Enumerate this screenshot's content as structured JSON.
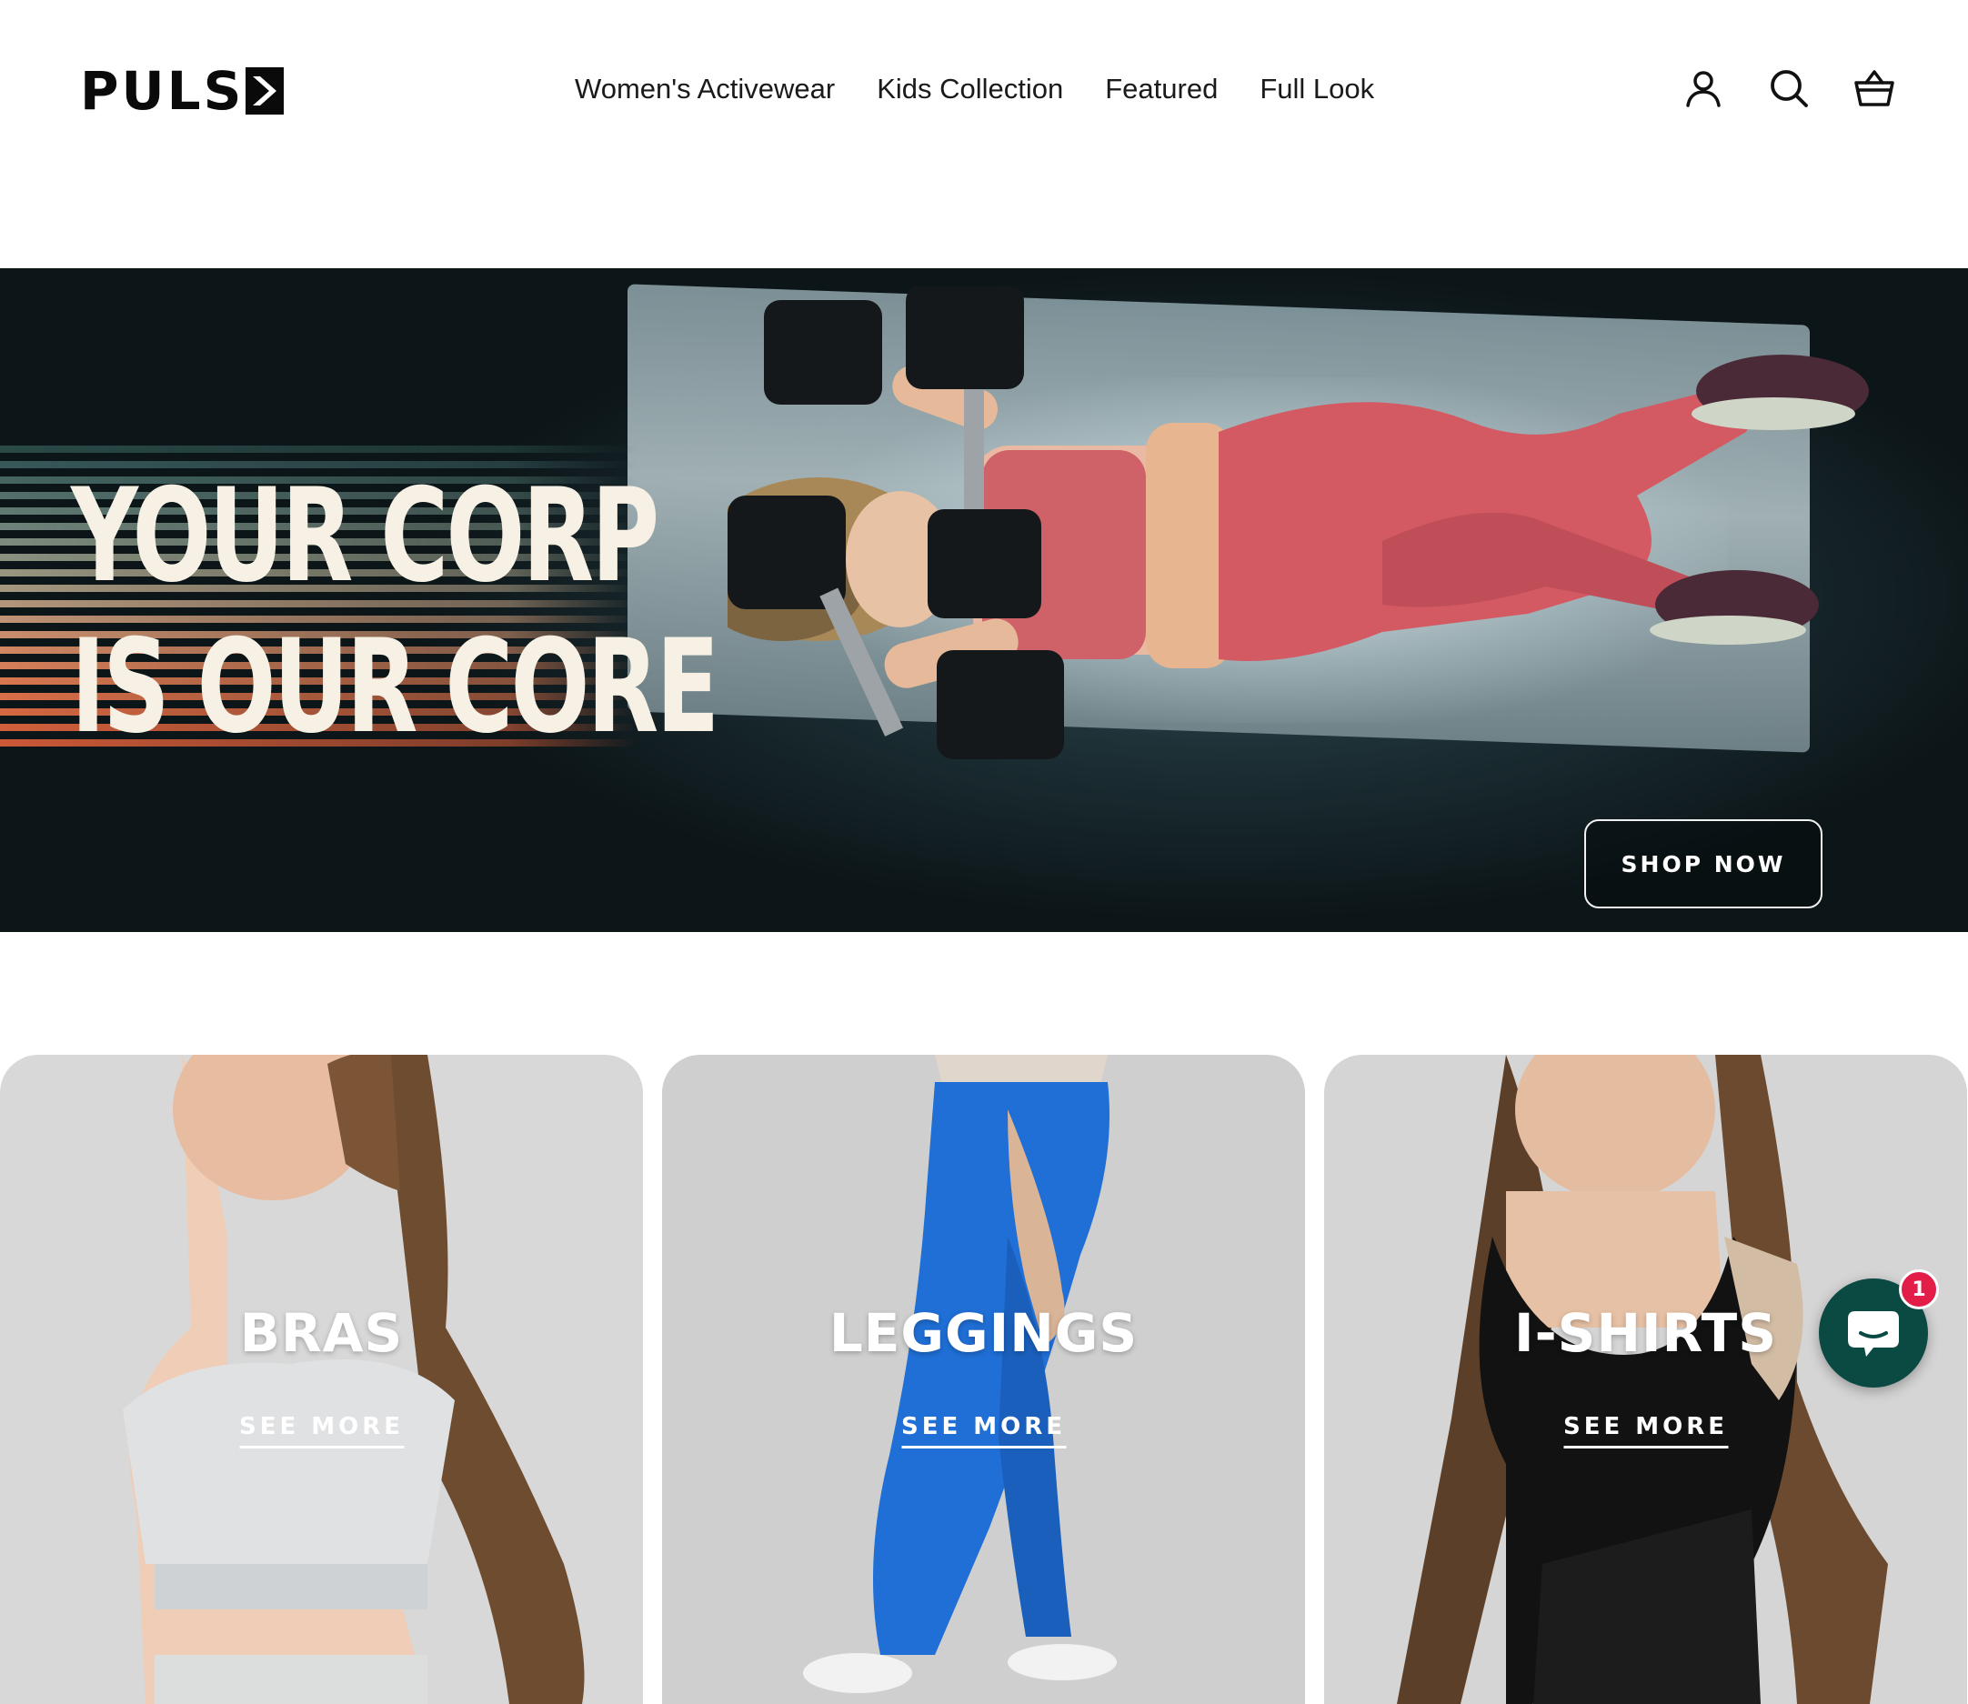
{
  "header": {
    "logo_text": "PULS",
    "nav": [
      {
        "label": "Women's Activewear"
      },
      {
        "label": "Kids Collection"
      },
      {
        "label": "Featured"
      },
      {
        "label": "Full Look"
      }
    ],
    "icons": [
      "account-icon",
      "search-icon",
      "cart-icon"
    ]
  },
  "hero": {
    "title_line1": "YOUR CORP",
    "title_line2": "IS OUR CORE",
    "cta_label": "SHOP NOW"
  },
  "categories": [
    {
      "title": "BRAS",
      "link": "SEE MORE",
      "bg": "#d9d8d8"
    },
    {
      "title": "LEGGINGS",
      "link": "SEE MORE",
      "bg": "#cfcfcf"
    },
    {
      "title": "I-SHIRTS",
      "link": "SEE MORE",
      "bg": "#d6d5d5"
    }
  ],
  "chat": {
    "badge_count": "1",
    "color": "#0b4a42"
  },
  "colors": {
    "hero_text": "#f6f1e4",
    "legging_blue": "#1f6fd6",
    "hero_pink": "#d9606a"
  }
}
